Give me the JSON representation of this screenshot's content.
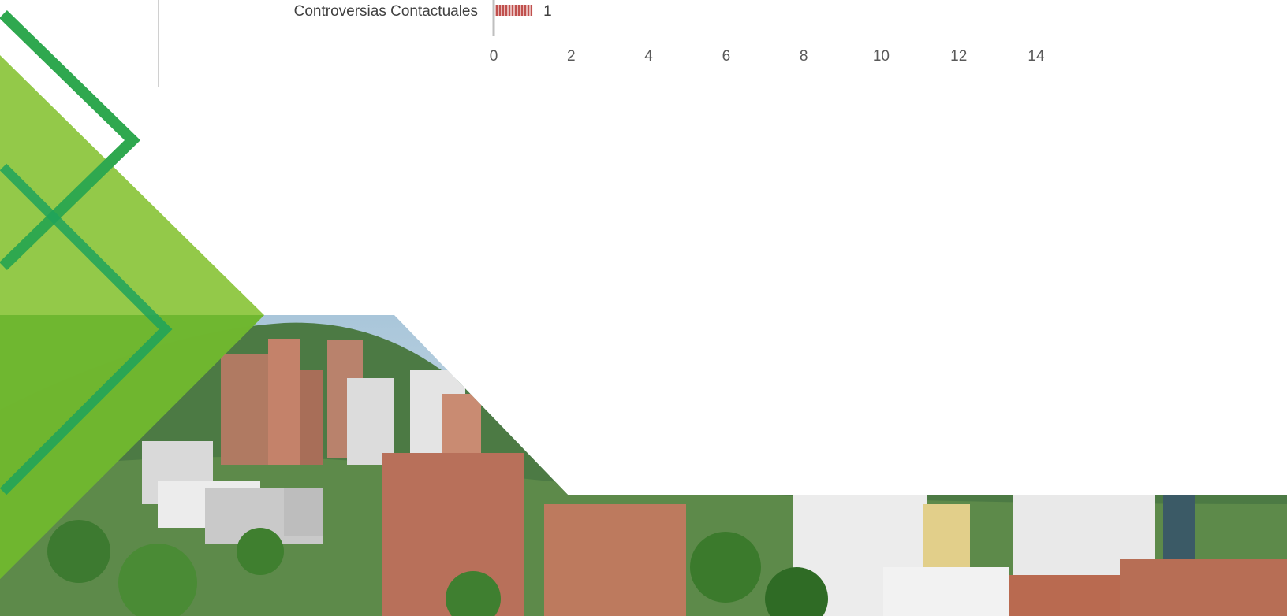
{
  "chart_data": {
    "type": "bar",
    "orientation": "horizontal",
    "categories": [
      "Controversias Contactuales"
    ],
    "values": [
      1
    ],
    "xlim": [
      0,
      14
    ],
    "x_ticks": [
      0,
      2,
      4,
      6,
      8,
      10,
      12,
      14
    ],
    "x_tick_labels": [
      "0",
      "2",
      "4",
      "6",
      "8",
      "10",
      "12",
      "14"
    ],
    "data_labels": [
      "1"
    ],
    "grid": false,
    "bar_color": "#c0504d",
    "title": "",
    "xlabel": "",
    "ylabel": ""
  },
  "cover_image": {
    "description_icon": "city-skyline-photo"
  },
  "colors": {
    "green_light": "#8dc63f",
    "green_mid": "#6ab42d",
    "green_dark": "#1aa54b",
    "sky": "#d8e6ef",
    "hill": "#3f6b3a",
    "building_brick": "#b8705a",
    "building_white": "#e8e8e8"
  }
}
